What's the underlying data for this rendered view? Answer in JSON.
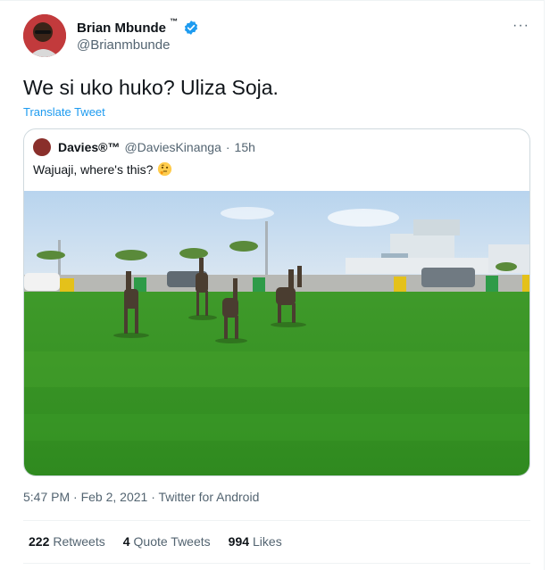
{
  "author": {
    "name": "Brian Mbunde",
    "tm": "™",
    "handle": "@Brianmbunde"
  },
  "more_label": "···",
  "tweet_text": "We si uko huko? Uliza Soja.",
  "translate_label": "Translate Tweet",
  "quoted": {
    "name": "Davies®™",
    "handle": "@DaviesKinanga",
    "dot": "·",
    "age": "15h",
    "text": "Wajuaji, where's this?",
    "emoji_icon": "thinking-face-icon"
  },
  "meta": {
    "time": "5:47 PM",
    "date": "Feb 2, 2021",
    "source": "Twitter for Android",
    "sep": "·"
  },
  "stats": {
    "retweets_count": "222",
    "retweets_label": "Retweets",
    "quotes_count": "4",
    "quotes_label": "Quote Tweets",
    "likes_count": "994",
    "likes_label": "Likes"
  },
  "colors": {
    "accent": "#1d9bf0",
    "secondary_text": "#536471",
    "border": "#cfd9de"
  }
}
